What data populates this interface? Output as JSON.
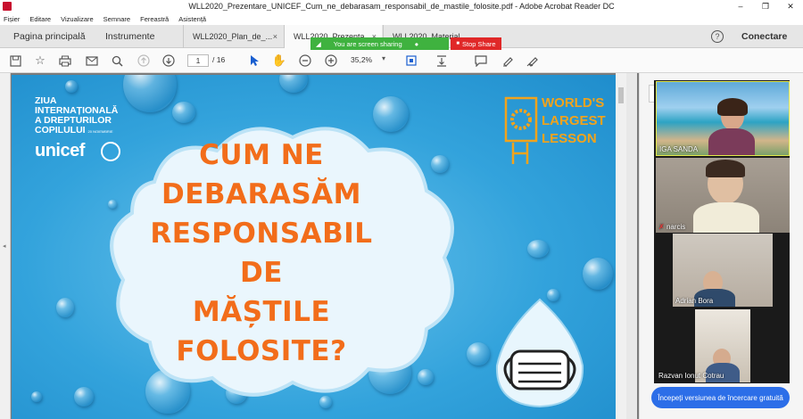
{
  "window": {
    "title": "WLL2020_Prezentare_UNICEF_Cum_ne_debarasam_responsabil_de_mastile_folosite.pdf - Adobe Acrobat Reader DC",
    "minimize": "–",
    "maximize": "❐",
    "close": "✕"
  },
  "menu": [
    "Fișier",
    "Editare",
    "Vizualizare",
    "Semnare",
    "Fereastră",
    "Asistență"
  ],
  "tabs": {
    "home": "Pagina principală",
    "tools": "Instrumente",
    "docs": [
      {
        "label": "WLL2020_Plan_de_...",
        "close": "×"
      },
      {
        "label": "WLL2020_Prezenta...",
        "close": "×"
      },
      {
        "label": "WLL2020_Material_...",
        "close": ""
      }
    ],
    "help": "?",
    "connect": "Conectare"
  },
  "screen_share": {
    "status": "You are screen sharing",
    "stop": "Stop Share"
  },
  "toolbar": {
    "page_current": "1",
    "page_total": "/ 16",
    "zoom": "35,2%"
  },
  "slide": {
    "org_line1": "ZIUA",
    "org_line2": "INTERNAȚIONALĂ",
    "org_line3": "A DREPTURILOR",
    "org_line4": "COPILULUI",
    "org_date": "20 NOIEMBRIE",
    "logo": "unicef",
    "title_lines": [
      "CUM NE",
      "DEBARASĂM",
      "RESPONSABIL DE",
      "MĂȘTILE",
      "FOLOSITE?"
    ],
    "wll_lines": [
      "WORLD'S",
      "LARGEST",
      "LESSON"
    ]
  },
  "participants": [
    {
      "name": "IGA SANDA"
    },
    {
      "name": "narcis"
    },
    {
      "name": "Adrian Bora"
    },
    {
      "name": "Razvan Ionut Cotrau"
    }
  ],
  "trial_button": "Începeți versiunea de încercare gratuită",
  "colors": {
    "title_orange": "#f26d1a",
    "share_green": "#3fb23f",
    "share_red": "#e02828",
    "trial_blue": "#2c6ee8"
  }
}
